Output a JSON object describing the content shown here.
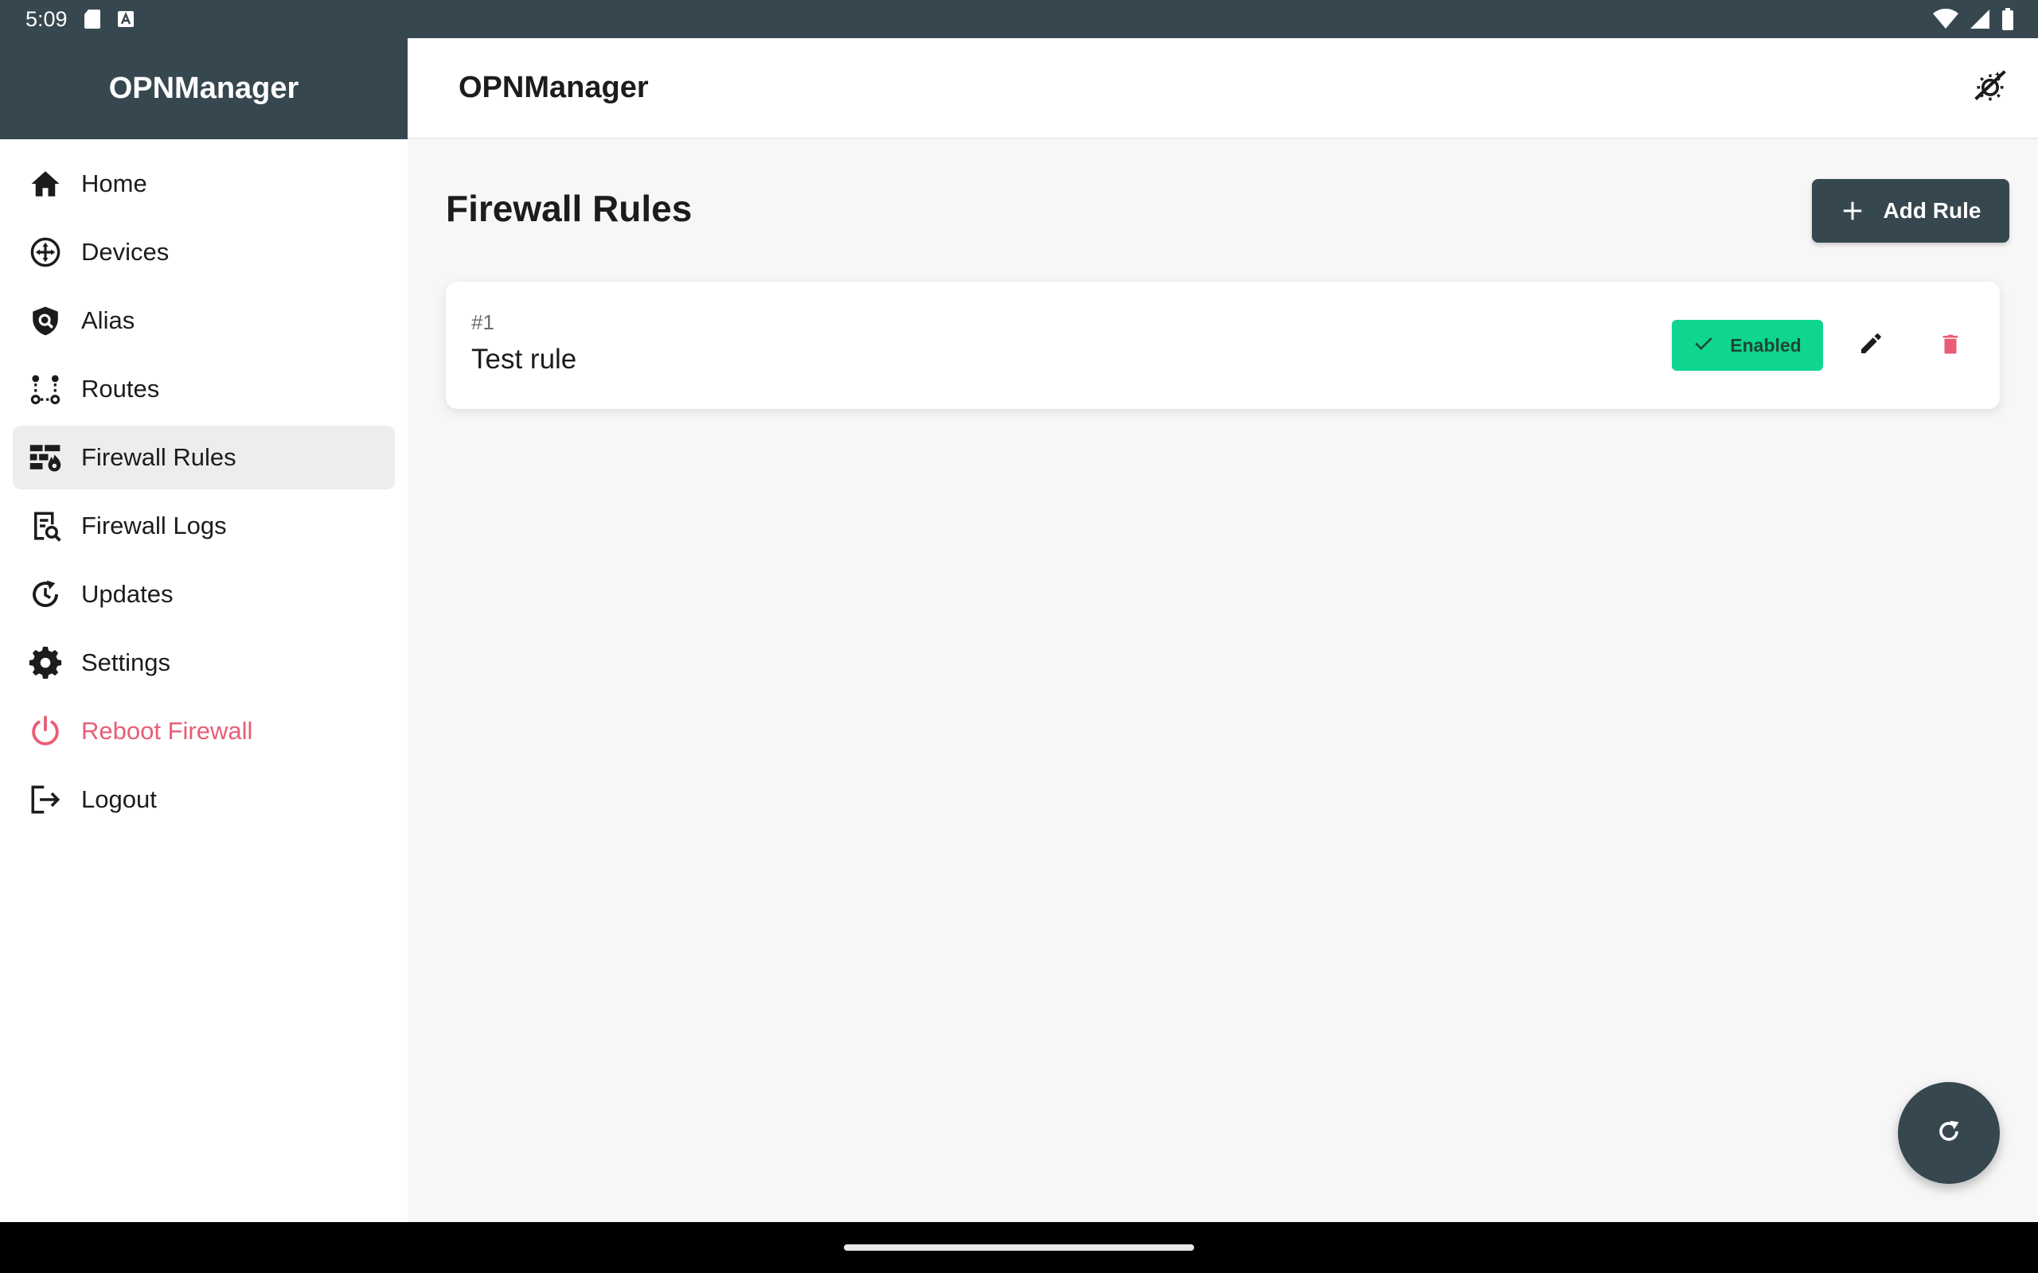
{
  "status_bar": {
    "time": "5:09",
    "icons": [
      "sd-card-icon",
      "a-badge-icon",
      "wifi-icon",
      "signal-icon",
      "battery-icon"
    ]
  },
  "sidebar": {
    "title": "OPNManager",
    "items": [
      {
        "label": "Home",
        "icon": "home-icon",
        "active": false
      },
      {
        "label": "Devices",
        "icon": "devices-icon",
        "active": false
      },
      {
        "label": "Alias",
        "icon": "alias-shield-icon",
        "active": false
      },
      {
        "label": "Routes",
        "icon": "routes-icon",
        "active": false
      },
      {
        "label": "Firewall Rules",
        "icon": "firewall-rules-icon",
        "active": true
      },
      {
        "label": "Firewall Logs",
        "icon": "firewall-logs-icon",
        "active": false
      },
      {
        "label": "Updates",
        "icon": "updates-icon",
        "active": false
      },
      {
        "label": "Settings",
        "icon": "gear-icon",
        "active": false
      },
      {
        "label": "Reboot Firewall",
        "icon": "power-icon",
        "active": false
      },
      {
        "label": "Logout",
        "icon": "logout-icon",
        "active": false
      }
    ]
  },
  "topbar": {
    "title": "OPNManager",
    "theme_toggle_icon": "theme-toggle-icon"
  },
  "main": {
    "page_title": "Firewall Rules",
    "add_rule_label": "Add Rule",
    "rules": [
      {
        "number": "#1",
        "name": "Test rule",
        "status": "Enabled"
      }
    ]
  },
  "colors": {
    "primary": "#37474f",
    "enabled_green": "#0fd68f",
    "danger": "#e95d75",
    "background": "#f7f7f7"
  }
}
